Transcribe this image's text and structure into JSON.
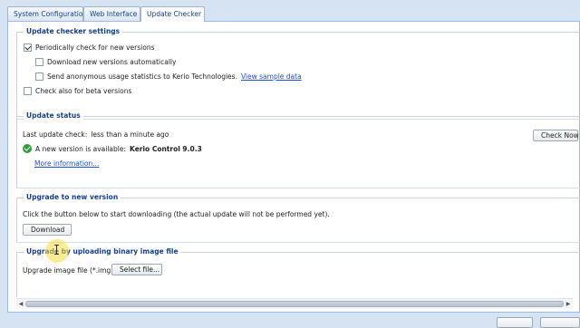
{
  "tabs": [
    {
      "label": "System Configuration"
    },
    {
      "label": "Web Interface"
    },
    {
      "label": "Update Checker"
    }
  ],
  "settings": {
    "title": "Update checker settings",
    "periodic": {
      "label": "Periodically check for new versions",
      "checked": true
    },
    "download_auto": {
      "label": "Download new versions automatically",
      "checked": false
    },
    "anon_stats": {
      "label": "Send anonymous usage statistics to Kerio Technologies.",
      "checked": false,
      "link": "View sample data"
    },
    "beta": {
      "label": "Check also for beta versions",
      "checked": false
    }
  },
  "status": {
    "title": "Update status",
    "last_check_label": "Last update check:",
    "last_check_value": "less than a minute ago",
    "check_now_button": "Check Now",
    "available_label": "A new version is available:",
    "available_version": "Kerio Control 9.0.3",
    "more_info_link": "More information..."
  },
  "upgrade": {
    "title": "Upgrade to new version",
    "instruction": "Click the button below to start downloading (the actual update will not be performed yet).",
    "download_button": "Download"
  },
  "binary": {
    "title": "Upgrade by uploading binary image file",
    "file_label": "Upgrade image file (*.img):",
    "select_button": "Select file..."
  },
  "colors": {
    "accent": "#15428b",
    "link": "#1a4fd8",
    "success": "#2e9e3a"
  },
  "icons": [
    "checkmark-circle-icon",
    "scroll-left-arrow-icon",
    "scroll-right-arrow-icon"
  ]
}
